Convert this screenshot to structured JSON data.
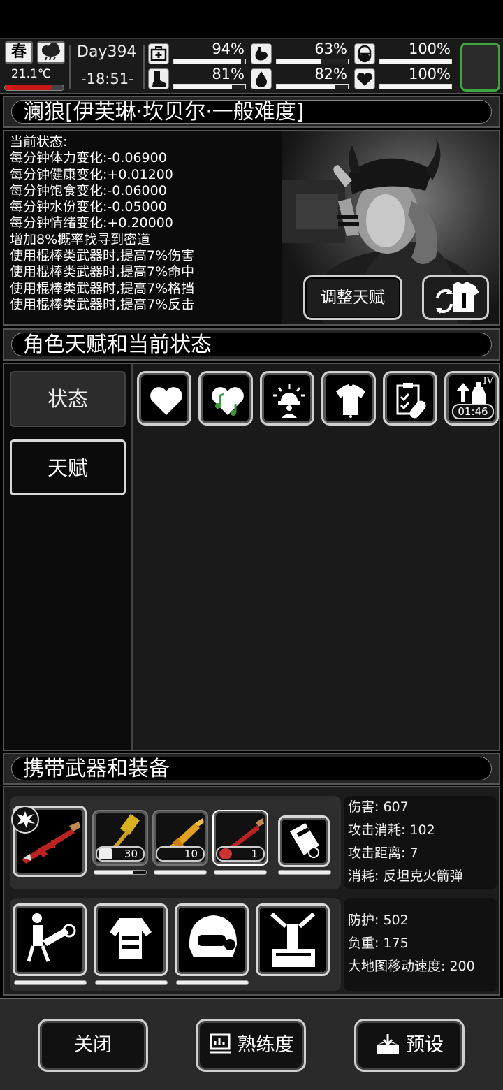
{
  "topbar": {
    "season": "春",
    "temperature": "21.1℃",
    "temperature_fill": 0.8,
    "day": "Day394",
    "time": "-18:51-",
    "stats": [
      {
        "name": "health",
        "icon": "medkit-icon",
        "pct": "94%",
        "fill": 0.94
      },
      {
        "name": "hunger",
        "icon": "stomach-icon",
        "pct": "63%",
        "fill": 0.63
      },
      {
        "name": "mood-pill",
        "icon": "pill-icon",
        "pct": "100%",
        "fill": 1.0
      },
      {
        "name": "stamina",
        "icon": "boot-icon",
        "pct": "81%",
        "fill": 0.81
      },
      {
        "name": "thirst",
        "icon": "water-drop-icon",
        "pct": "82%",
        "fill": 0.82
      },
      {
        "name": "emotion",
        "icon": "heart-icon",
        "pct": "100%",
        "fill": 1.0
      }
    ]
  },
  "character": {
    "title": "澜狼[伊芙琳·坎贝尔·一般难度]",
    "status_lines": [
      "当前状态:",
      "每分钟体力变化:-0.06900",
      "每分钟健康变化:+0.01200",
      "每分钟饱食变化:-0.06000",
      "每分钟水份变化:-0.05000",
      "每分钟情绪变化:+0.20000",
      "增加8%概率找寻到密道",
      "使用棍棒类武器时,提高7%伤害",
      "使用棍棒类武器时,提高7%命中",
      "使用棍棒类武器时,提高7%格挡",
      "使用棍棒类武器时,提高7%反击"
    ],
    "adjust_talent_label": "调整天赋"
  },
  "talent_section": {
    "title": "角色天赋和当前状态",
    "tabs": [
      "状态",
      "天赋"
    ],
    "status_icons": [
      {
        "name": "heart-status-icon"
      },
      {
        "name": "music-heart-status-icon"
      },
      {
        "name": "alarm-person-status-icon"
      },
      {
        "name": "clothing-status-icon"
      },
      {
        "name": "medical-record-status-icon"
      },
      {
        "name": "buff-bottle-status-icon",
        "level": "IV",
        "timer": "01:46"
      }
    ]
  },
  "equipment": {
    "title": "携带武器和装备",
    "weapon_counts": [
      "30",
      "10",
      "1"
    ],
    "weapon_durability": [
      0.75,
      1.0,
      1.0,
      1.0
    ],
    "armor_durability": [
      1.0,
      1.0,
      1.0
    ],
    "weapon_info": [
      "伤害: 607",
      "攻击消耗: 102",
      "攻击距离: 7",
      "消耗: 反坦克火箭弹"
    ],
    "armor_info": [
      "防护: 502",
      "负重: 175",
      "大地图移动速度: 200"
    ]
  },
  "footer": {
    "close": "关闭",
    "proficiency": "熟练度",
    "preset": "预设"
  }
}
